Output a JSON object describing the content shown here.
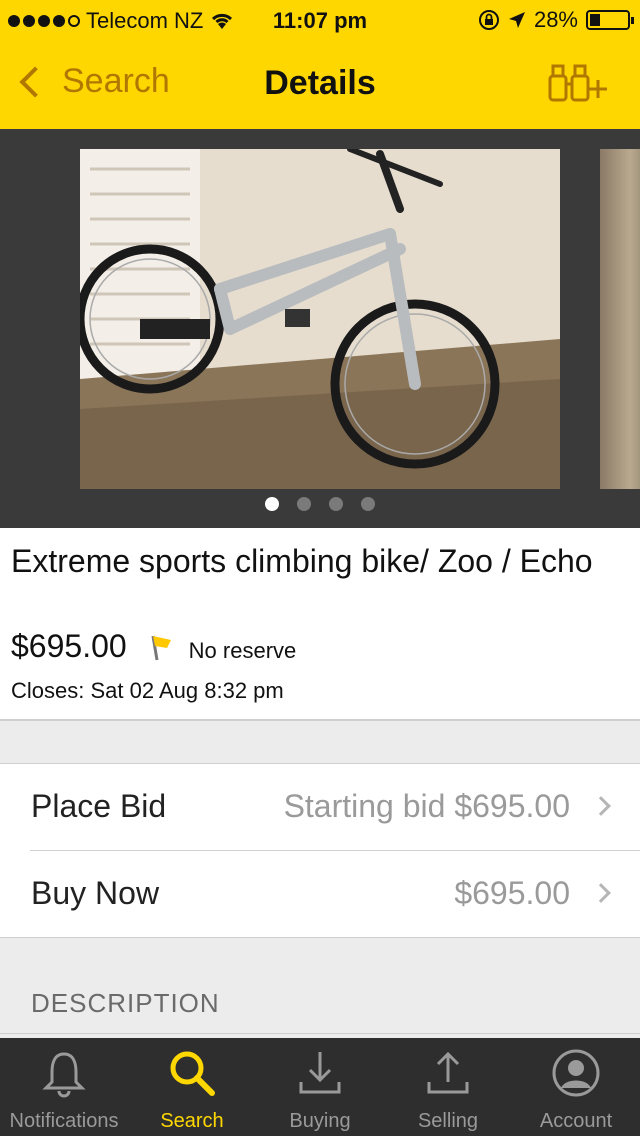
{
  "status_bar": {
    "carrier": "Telecom NZ",
    "signal_bars_filled": 4,
    "time": "11:07 pm",
    "battery_percent": "28%",
    "battery_level": 0.28
  },
  "nav": {
    "back_label": "Search",
    "title": "Details",
    "watchlist_icon": "binoculars-plus-icon"
  },
  "gallery": {
    "photo_count": 4,
    "current_index": 0
  },
  "listing": {
    "title": "Extreme sports climbing bike/ Zoo / Echo",
    "price": "$695.00",
    "reserve": "No reserve",
    "closes": "Closes: Sat 02 Aug 8:32 pm"
  },
  "actions": {
    "place_bid": {
      "label": "Place Bid",
      "value": "Starting bid $695.00"
    },
    "buy_now": {
      "label": "Buy Now",
      "value": "$695.00"
    }
  },
  "section": {
    "description_heading": "DESCRIPTION"
  },
  "tabs": [
    {
      "label": "Notifications",
      "icon": "bell-icon"
    },
    {
      "label": "Search",
      "icon": "search-icon"
    },
    {
      "label": "Buying",
      "icon": "download-icon"
    },
    {
      "label": "Selling",
      "icon": "upload-icon"
    },
    {
      "label": "Account",
      "icon": "account-icon"
    }
  ],
  "colors": {
    "brand_yellow": "#ffd700",
    "back_text": "#b07800",
    "tabbar_bg": "#2e2e2e"
  }
}
